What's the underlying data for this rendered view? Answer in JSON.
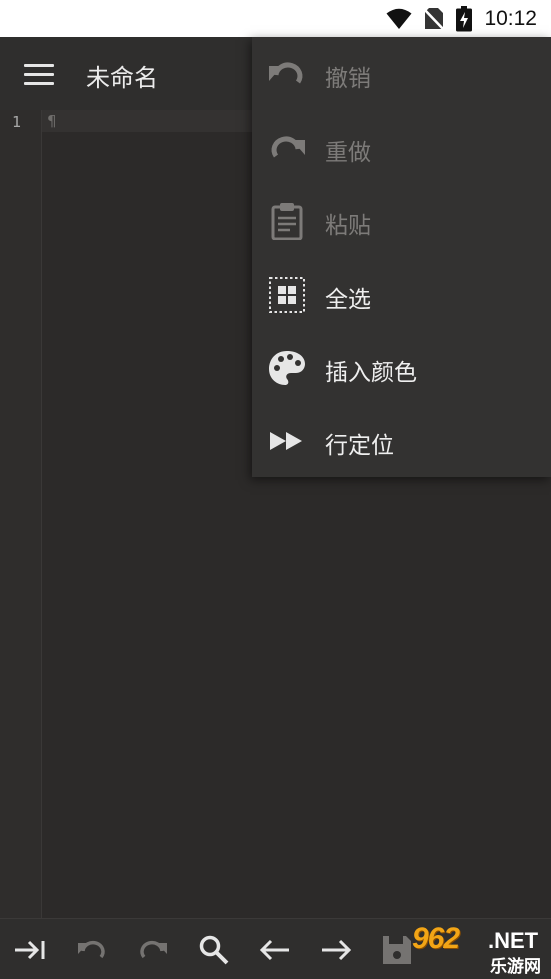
{
  "status_bar": {
    "time": "10:12",
    "icons": [
      "wifi-icon",
      "no-sim-icon",
      "battery-charging-icon"
    ]
  },
  "app_bar": {
    "title": "未命名",
    "menu_icon": "hamburger-menu-icon"
  },
  "editor": {
    "line_numbers": [
      "1"
    ],
    "pilcrow": "¶"
  },
  "overflow_menu": {
    "items": [
      {
        "label": "撤销",
        "icon": "undo-icon",
        "enabled": false
      },
      {
        "label": "重做",
        "icon": "redo-icon",
        "enabled": false
      },
      {
        "label": "粘贴",
        "icon": "clipboard-icon",
        "enabled": false
      },
      {
        "label": "全选",
        "icon": "select-all-icon",
        "enabled": true
      },
      {
        "label": "插入颜色",
        "icon": "palette-icon",
        "enabled": true
      },
      {
        "label": "行定位",
        "icon": "fast-forward-icon",
        "enabled": true
      }
    ]
  },
  "bottom_toolbar": {
    "items": [
      "tab-indent-icon",
      "undo-icon",
      "redo-icon",
      "search-icon",
      "arrow-left-icon",
      "arrow-right-icon",
      "save-icon"
    ]
  },
  "watermark": {
    "brand": "962",
    "suffix": ".NET",
    "subtitle": "乐游网"
  },
  "colors": {
    "background": "#2c2a29",
    "app_bar": "#2f2e2d",
    "menu_background": "#333231",
    "disabled_text": "#7d7b79",
    "enabled_text": "#efefef",
    "watermark": "#f2a516"
  }
}
